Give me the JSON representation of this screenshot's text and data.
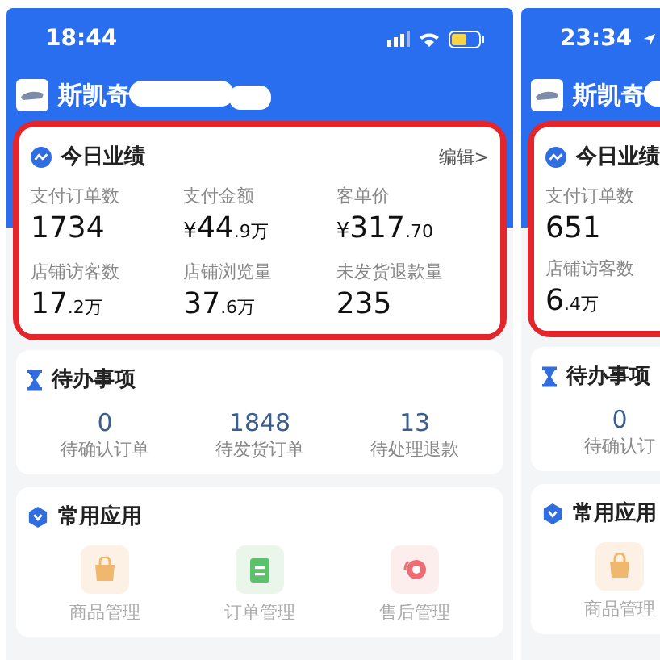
{
  "phones": [
    {
      "time": "18:44",
      "location": false,
      "status_icons": true,
      "brand": "斯凯奇",
      "brand_redacted": true,
      "performance": {
        "title": "今日业绩",
        "edit": "编辑>",
        "highlighted": true,
        "rows": [
          [
            {
              "label": "支付订单数",
              "value": "1734"
            },
            {
              "label": "支付金额",
              "prefix": "¥",
              "value": "44",
              "small": ".9万"
            },
            {
              "label": "客单价",
              "prefix": "¥",
              "value": "317",
              "small": ".70"
            }
          ],
          [
            {
              "label": "店铺访客数",
              "value": "17",
              "small": ".2万"
            },
            {
              "label": "店铺浏览量",
              "value": "37",
              "small": ".6万"
            },
            {
              "label": "未发货退款量",
              "value": "235"
            }
          ]
        ]
      },
      "todo": {
        "title": "待办事项",
        "items": [
          {
            "count": "0",
            "label": "待确认订单"
          },
          {
            "count": "1848",
            "label": "待发货订单"
          },
          {
            "count": "13",
            "label": "待处理退款"
          }
        ]
      },
      "apps": {
        "title": "常用应用",
        "items": [
          {
            "kind": "goods",
            "label": "商品管理"
          },
          {
            "kind": "orders",
            "label": "订单管理"
          },
          {
            "kind": "aftersale",
            "label": "售后管理"
          }
        ]
      }
    },
    {
      "time": "23:34",
      "location": true,
      "brand": "斯凯奇",
      "brand_redacted": true,
      "performance": {
        "title": "今日业绩",
        "highlighted": true,
        "rows": [
          [
            {
              "label": "支付订单数",
              "value": "651"
            }
          ],
          [
            {
              "label": "店铺访客数",
              "value": "6",
              "small": ".4万"
            }
          ]
        ]
      },
      "todo": {
        "title": "待办事项",
        "items": [
          {
            "count": "0",
            "label": "待确认订"
          }
        ]
      },
      "apps": {
        "title": "常用应用",
        "items": [
          {
            "kind": "goods",
            "label": "商品管理"
          }
        ]
      }
    }
  ]
}
